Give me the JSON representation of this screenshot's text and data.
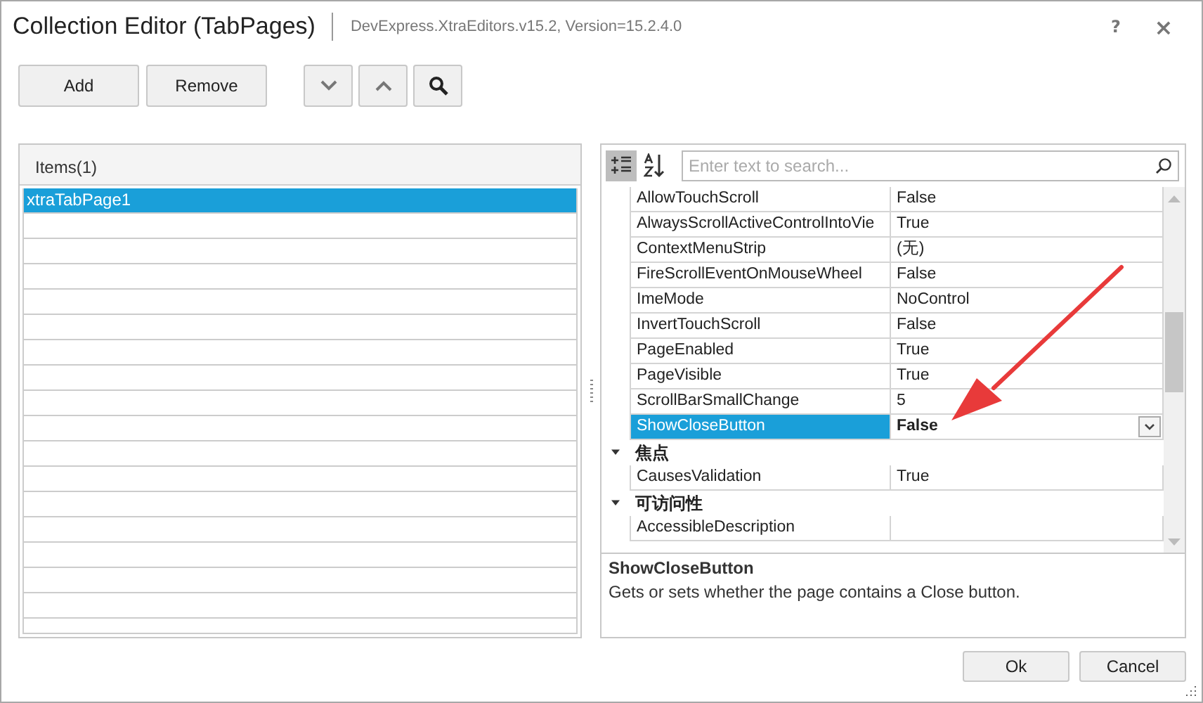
{
  "window": {
    "title": "Collection Editor (TabPages)",
    "subtitle": "DevExpress.XtraEditors.v15.2, Version=15.2.4.0",
    "help": "?",
    "close": "×"
  },
  "toolbar": [
    {
      "kind": "text",
      "label": "Add"
    },
    {
      "kind": "text",
      "label": "Remove"
    },
    {
      "kind": "move-down"
    },
    {
      "kind": "move-up"
    },
    {
      "kind": "search"
    }
  ],
  "items_list": {
    "header": "Items(1)",
    "items": [
      {
        "label": "xtraTabPage1",
        "selected": true
      }
    ]
  },
  "property_grid": {
    "view_buttons": [
      {
        "kind": "categorized",
        "selected": true
      },
      {
        "kind": "alphabetical",
        "selected": false
      }
    ],
    "search": {
      "placeholder": "Enter text to search..."
    },
    "rows": [
      {
        "kind": "property",
        "name": "AllowTouchScroll",
        "value": "False",
        "selected": false,
        "modified": false
      },
      {
        "kind": "property",
        "name": "AlwaysScrollActiveControlIntoVie",
        "value": "True",
        "selected": false,
        "modified": false
      },
      {
        "kind": "property",
        "name": "ContextMenuStrip",
        "value": "(无)",
        "selected": false,
        "modified": false
      },
      {
        "kind": "property",
        "name": "FireScrollEventOnMouseWheel",
        "value": "False",
        "selected": false,
        "modified": false
      },
      {
        "kind": "property",
        "name": "ImeMode",
        "value": "NoControl",
        "selected": false,
        "modified": false
      },
      {
        "kind": "property",
        "name": "InvertTouchScroll",
        "value": "False",
        "selected": false,
        "modified": false
      },
      {
        "kind": "property",
        "name": "PageEnabled",
        "value": "True",
        "selected": false,
        "modified": false
      },
      {
        "kind": "property",
        "name": "PageVisible",
        "value": "True",
        "selected": false,
        "modified": false
      },
      {
        "kind": "property",
        "name": "ScrollBarSmallChange",
        "value": "5",
        "selected": false,
        "modified": false
      },
      {
        "kind": "property",
        "name": "ShowCloseButton",
        "value": "False",
        "selected": true,
        "modified": true
      },
      {
        "kind": "category",
        "name": "焦点",
        "expanded": true
      },
      {
        "kind": "property",
        "name": "CausesValidation",
        "value": "True",
        "selected": false,
        "modified": false
      },
      {
        "kind": "category",
        "name": "可访问性",
        "expanded": true
      },
      {
        "kind": "property",
        "name": "AccessibleDescription",
        "value": "",
        "selected": false,
        "modified": false
      }
    ],
    "description": {
      "title": "ShowCloseButton",
      "text": "Gets or sets whether the page contains a Close button."
    }
  },
  "buttons": [
    "Ok",
    "Cancel"
  ]
}
